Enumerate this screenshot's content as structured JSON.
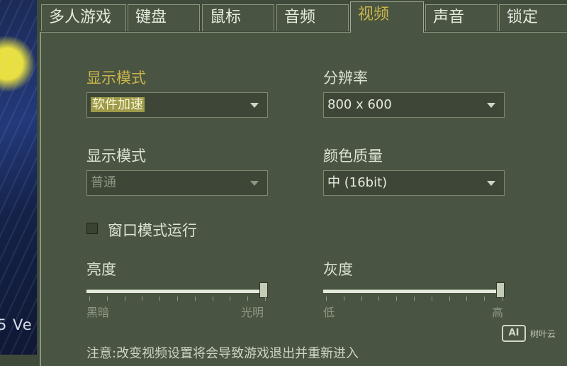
{
  "background": {
    "edge_text": "5 Ve"
  },
  "tabs": [
    {
      "label": "多人游戏",
      "active": false
    },
    {
      "label": "键盘",
      "active": false
    },
    {
      "label": "鼠标",
      "active": false
    },
    {
      "label": "音频",
      "active": false
    },
    {
      "label": "视频",
      "active": true
    },
    {
      "label": "声音",
      "active": false
    },
    {
      "label": "锁定",
      "active": false
    }
  ],
  "video": {
    "display_mode_label": "显示模式",
    "display_mode_value": "软件加速",
    "resolution_label": "分辨率",
    "resolution_value": "800 x 600",
    "display_mode2_label": "显示模式",
    "display_mode2_value": "普通",
    "color_quality_label": "颜色质量",
    "color_quality_value": "中 (16bit)",
    "windowed_label": "窗口模式运行",
    "windowed_checked": false,
    "brightness_label": "亮度",
    "brightness_min": "黑暗",
    "brightness_max": "光明",
    "brightness_level": 1.0,
    "gamma_label": "灰度",
    "gamma_min": "低",
    "gamma_max": "高",
    "gamma_level": 1.0,
    "note": "注意:改变视频设置将会导致游戏退出并重新进入"
  },
  "watermark": {
    "logo": "AI",
    "text": "树叶云"
  },
  "colors": {
    "panel": "#4a5442",
    "accent": "#c9b54a",
    "text": "#dde3d4"
  }
}
